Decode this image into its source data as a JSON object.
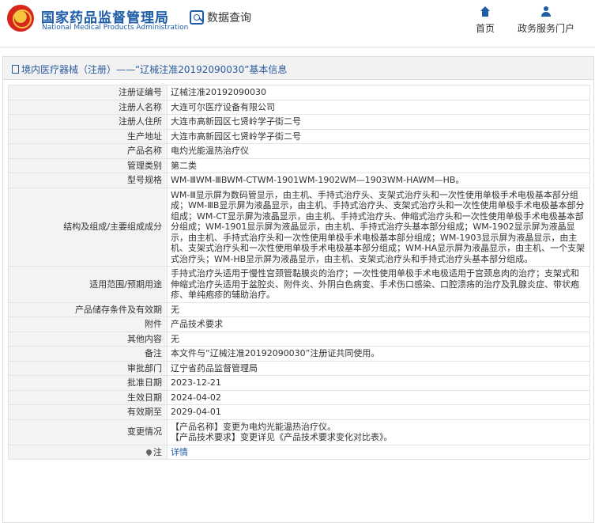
{
  "header": {
    "logo_cn": "国家药品监督管理局",
    "logo_en": "National Medical Products Administration",
    "query_title": "数据查询",
    "nav": [
      {
        "label": "首页",
        "icon": "home-icon"
      },
      {
        "label": "政务服务门户",
        "icon": "user-icon"
      }
    ],
    "brand_color": "#1e5ca8"
  },
  "panel": {
    "title": "境内医疗器械（注册）——“辽械注准20192090030”基本信息"
  },
  "rows": [
    {
      "label": "注册证编号",
      "value": "辽械注准20192090030"
    },
    {
      "label": "注册人名称",
      "value": "大连可尔医疗设备有限公司"
    },
    {
      "label": "注册人住所",
      "value": "大连市高新园区七贤岭学子街二号"
    },
    {
      "label": "生产地址",
      "value": "大连市高新园区七贤岭学子街二号"
    },
    {
      "label": "产品名称",
      "value": "电灼光能温热治疗仪"
    },
    {
      "label": "管理类别",
      "value": "第二类"
    },
    {
      "label": "型号规格",
      "value": "WM-ⅢWM-ⅢBWM-CTWM-1901WM-1902WM—1903WM-HAWM—HB。"
    },
    {
      "label": "结构及组成/主要组成成分",
      "value": "WM-Ⅲ显示屏为数码管显示，由主机、手持式治疗头、支架式治疗头和一次性使用单极手术电极基本部分组成；WM-ⅢB显示屏为液晶显示，由主机、手持式治疗头、支架式治疗头和一次性使用单极手术电极基本部分组成；WM-CT显示屏为液晶显示，由主机、手持式治疗头、伸缩式治疗头和一次性使用单极手术电极基本部分组成；WM-1901显示屏为液晶显示，由主机、手持式治疗头基本部分组成；WM-1902显示屏为液晶显示，由主机、手持式治疗头和一次性使用单极手术电极基本部分组成；WM-1903显示屏为液晶显示，由主机、支架式治疗头和一次性使用单极手术电极基本部分组成；WM-HA显示屏为液晶显示，由主机、一个支架式治疗头；WM-HB显示屏为液晶显示，由主机、支架式治疗头和手持式治疗头基本部分组成。"
    },
    {
      "label": "适用范围/预期用途",
      "value": "手持式治疗头适用于慢性宫颈管黏膜炎的治疗；一次性使用单极手术电极适用于宫颈息肉的治疗；支架式和伸缩式治疗头适用于盆腔炎、附件炎、外阴白色病变、手术伤口感染、口腔溃疡的治疗及乳腺炎症、带状疱疹、单纯疱疹的辅助治疗。"
    },
    {
      "label": "产品储存条件及有效期",
      "value": "无"
    },
    {
      "label": "附件",
      "value": "产品技术要求"
    },
    {
      "label": "其他内容",
      "value": "无"
    },
    {
      "label": "备注",
      "value": "本文件与“辽械注准20192090030”注册证共同使用。"
    },
    {
      "label": "审批部门",
      "value": "辽宁省药品监督管理局"
    },
    {
      "label": "批准日期",
      "value": "2023-12-21"
    },
    {
      "label": "生效日期",
      "value": "2024-04-02"
    },
    {
      "label": "有效期至",
      "value": "2029-04-01"
    },
    {
      "label": "变更情况",
      "value_line1": "【产品名称】变更为电灼光能温热治疗仪。",
      "value_line2": "【产品技术要求】变更详见《产品技术要求变化对比表》。"
    },
    {
      "label": "注",
      "value": "详情",
      "icon": "pin-icon"
    }
  ]
}
